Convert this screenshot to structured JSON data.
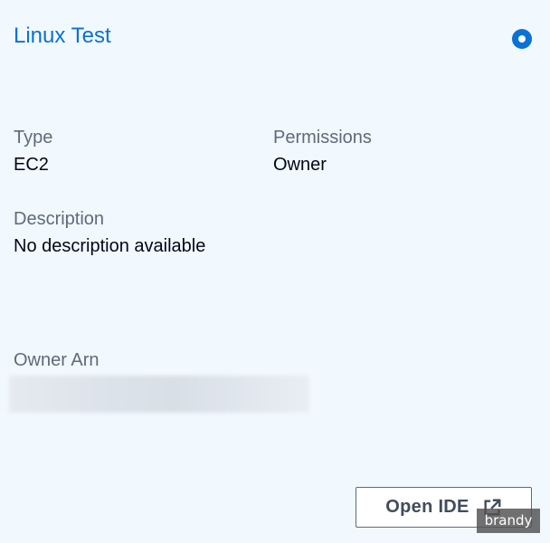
{
  "card": {
    "title": "Linux Test",
    "selected": true
  },
  "fields": {
    "type": {
      "label": "Type",
      "value": "EC2"
    },
    "permissions": {
      "label": "Permissions",
      "value": "Owner"
    },
    "description": {
      "label": "Description",
      "value": "No description available"
    },
    "owner_arn": {
      "label": "Owner Arn",
      "value_obscured": true
    }
  },
  "actions": {
    "open_ide_label": "Open IDE",
    "open_ide_icon": "external-link-icon"
  },
  "watermark": {
    "text": "brandy"
  },
  "colors": {
    "accent": "#0972d3",
    "background": "#f1f8fe",
    "label": "#5f6b7a",
    "value": "#000716",
    "button_text": "#414d5c"
  }
}
